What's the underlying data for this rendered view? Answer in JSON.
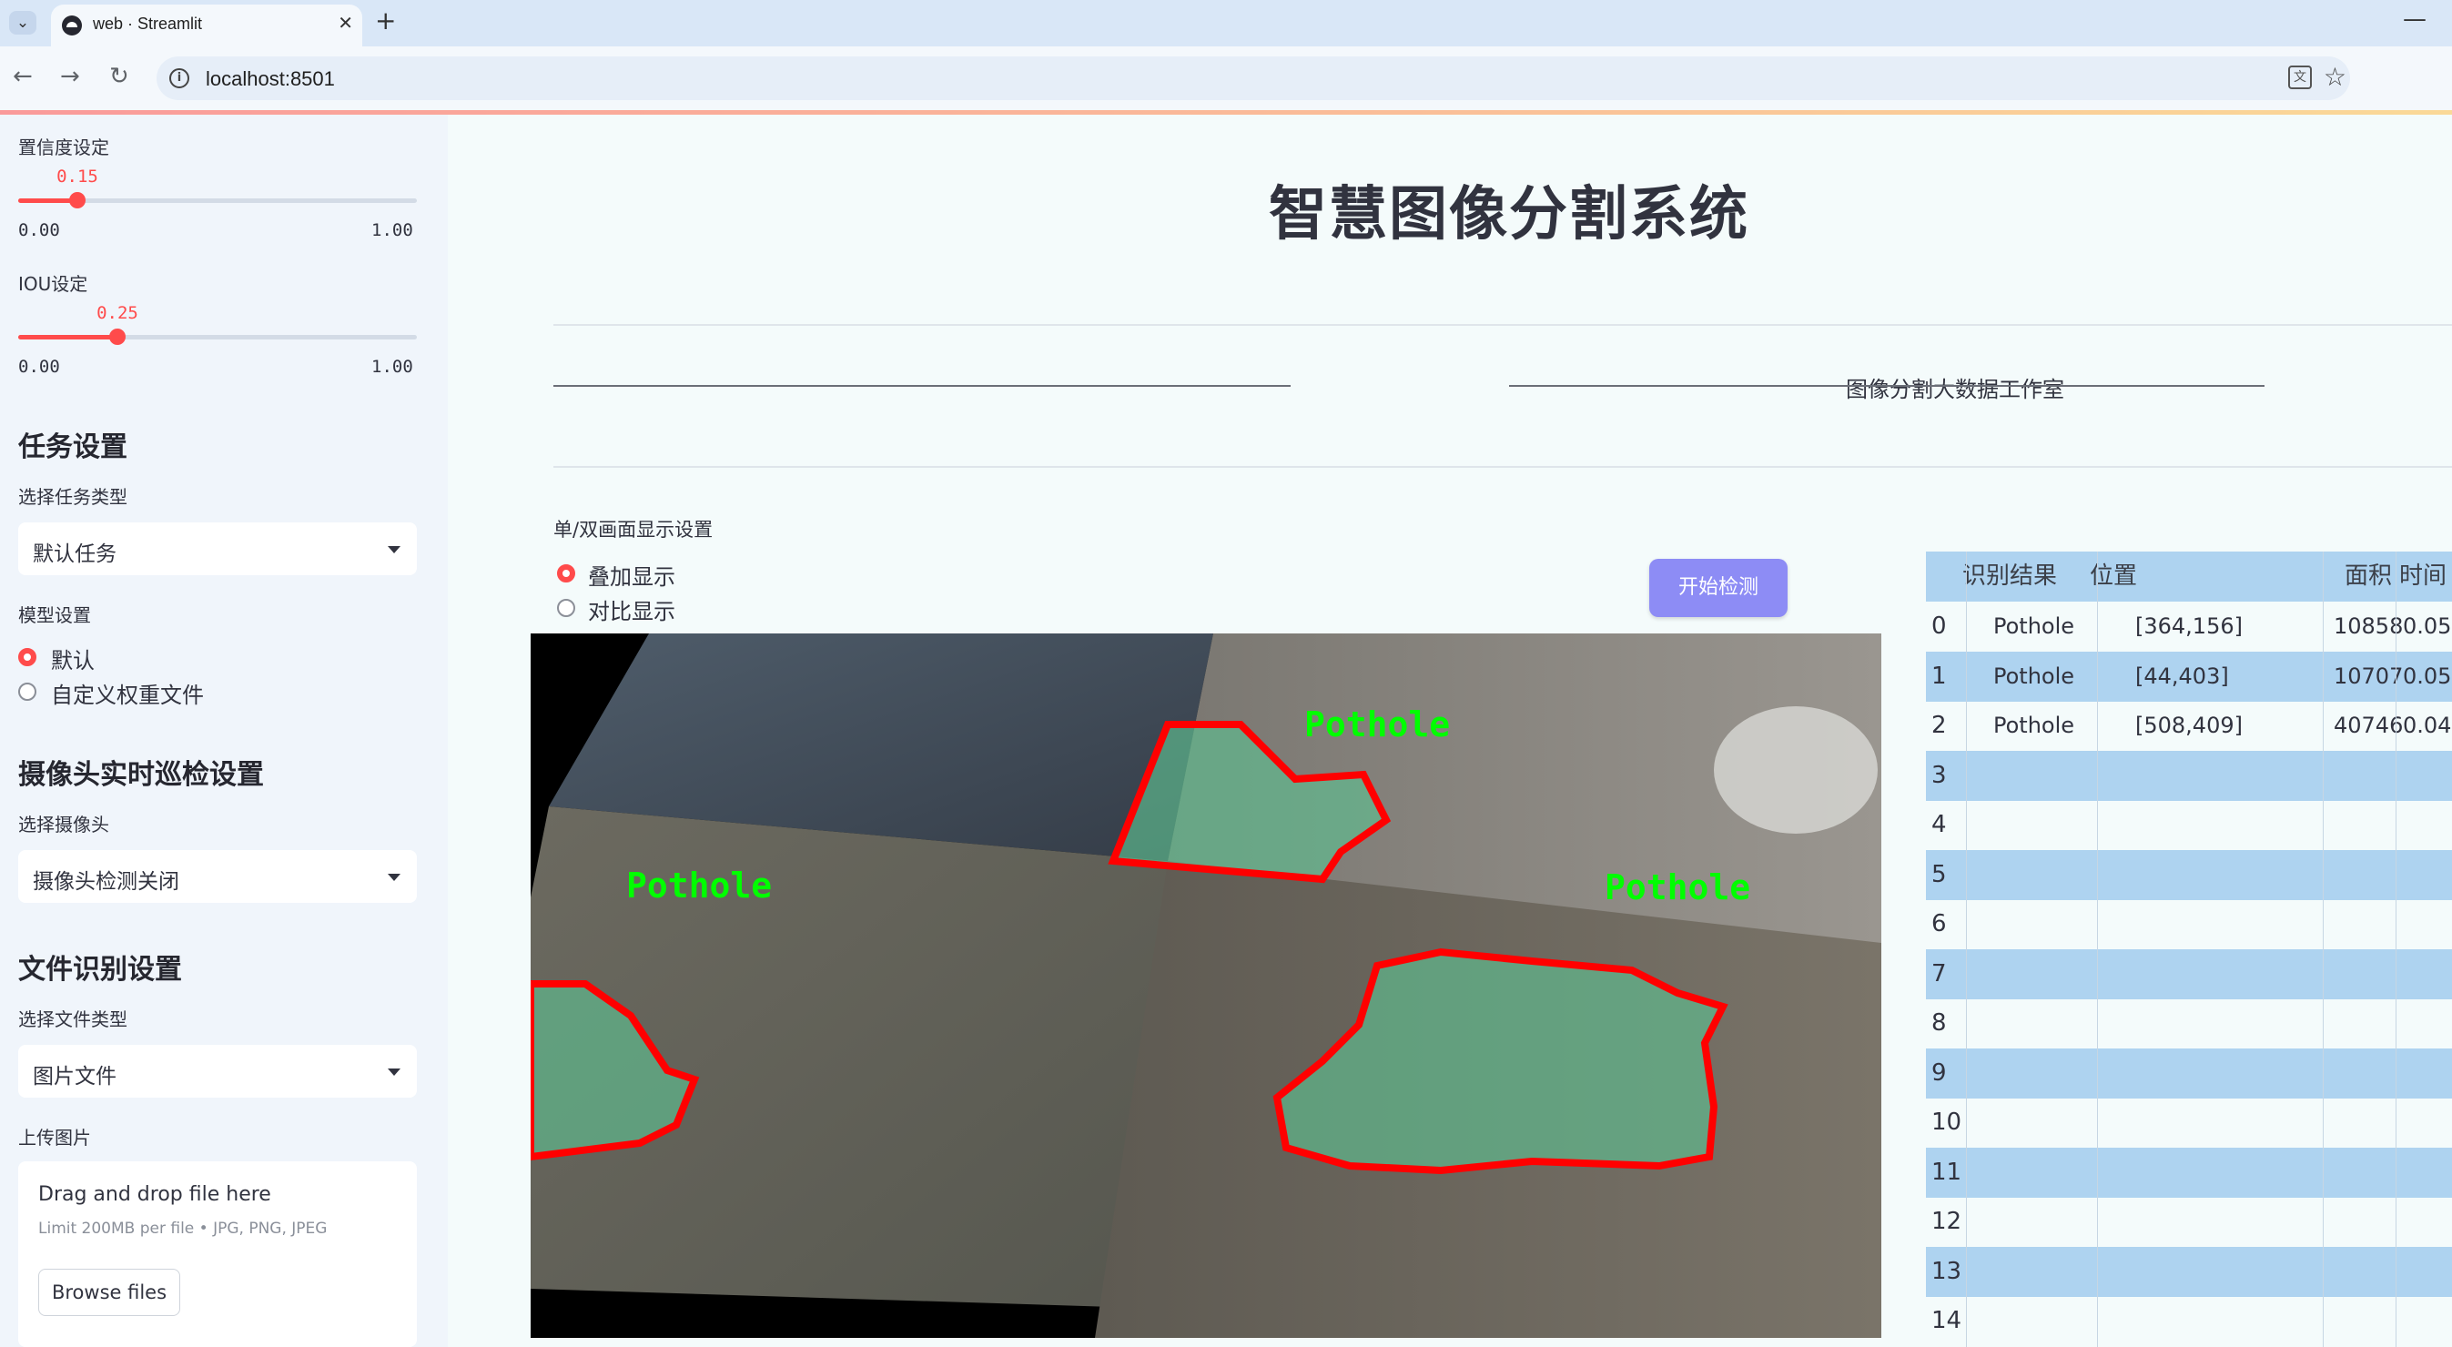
{
  "browser": {
    "tab_title": "web · Streamlit",
    "url": "localhost:8501"
  },
  "sidebar": {
    "confidence": {
      "label": "置信度设定",
      "value": 0.15,
      "value_text": "0.15",
      "min": "0.00",
      "max": "1.00"
    },
    "iou": {
      "label": "IOU设定",
      "value": 0.25,
      "value_text": "0.25",
      "min": "0.00",
      "max": "1.00"
    },
    "task_header": "任务设置",
    "task_type_label": "选择任务类型",
    "task_type_value": "默认任务",
    "model_label": "模型设置",
    "model_options": [
      "默认",
      "自定义权重文件"
    ],
    "model_selected": 0,
    "camera_header": "摄像头实时巡检设置",
    "camera_label": "选择摄像头",
    "camera_value": "摄像头检测关闭",
    "file_header": "文件识别设置",
    "file_type_label": "选择文件类型",
    "file_type_value": "图片文件",
    "upload_label": "上传图片",
    "upload_title": "Drag and drop file here",
    "upload_limit": "Limit 200MB per file • JPG, PNG, JPEG",
    "browse_label": "Browse files"
  },
  "main": {
    "title": "智慧图像分割系统",
    "divider_text": "图像分割大数据工作室",
    "display_label": "单/双画面显示设置",
    "display_options": [
      "叠加显示",
      "对比显示"
    ],
    "display_selected": 0,
    "detect_button": "开始检测",
    "detections_label": "Pothole"
  },
  "table": {
    "columns": [
      "识别结果",
      "位置",
      "面积",
      "时间"
    ],
    "rows": [
      {
        "index": "0",
        "result": "Pothole",
        "position": "[364,156]",
        "area": "10858",
        "time": "0.05"
      },
      {
        "index": "1",
        "result": "Pothole",
        "position": "[44,403]",
        "area": "10707",
        "time": "0.05"
      },
      {
        "index": "2",
        "result": "Pothole",
        "position": "[508,409]",
        "area": "40746",
        "time": "0.04"
      },
      {
        "index": "3"
      },
      {
        "index": "4"
      },
      {
        "index": "5"
      },
      {
        "index": "6"
      },
      {
        "index": "7"
      },
      {
        "index": "8"
      },
      {
        "index": "9"
      },
      {
        "index": "10"
      },
      {
        "index": "11"
      },
      {
        "index": "12"
      },
      {
        "index": "13"
      },
      {
        "index": "14"
      }
    ]
  },
  "colors": {
    "accent": "#ff4b4b",
    "button": "#8d8cf5",
    "table_stripe": "#aed3f0",
    "mask_outline": "#ff0000",
    "mask_label": "#00ff00"
  }
}
